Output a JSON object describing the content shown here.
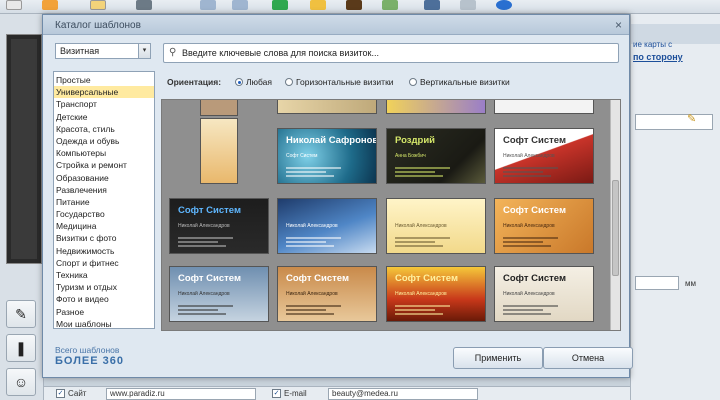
{
  "background": {
    "right_panel": {
      "link1": "ие карты с",
      "link2": "по сторону",
      "unit": "мм"
    },
    "bottom": {
      "site_label": "Сайт",
      "site_value": "www.paradiz.ru",
      "email_label": "E-mail",
      "email_value": "beauty@medea.ru"
    }
  },
  "dialog": {
    "title": "Каталог шаблонов",
    "category_select": "Визитная",
    "search_placeholder": "Введите ключевые слова для поиска визиток...",
    "categories": [
      "Простые",
      "Универсальные",
      "Транспорт",
      "Детские",
      "Красота, стиль",
      "Одежда и обувь",
      "Компьютеры",
      "Стройка и ремонт",
      "Образование",
      "Развлечения",
      "Питание",
      "Государство",
      "Медицина",
      "Визитки с фото",
      "Недвижимость",
      "Спорт и фитнес",
      "Техника",
      "Туризм и отдых",
      "Фото и видео",
      "Разное",
      "Мои шаблоны"
    ],
    "selected_category_index": 1,
    "orientation": {
      "label": "Ориентация:",
      "options": [
        "Любая",
        "Горизонтальные визитки",
        "Вертикальные визитки"
      ],
      "selected_index": 0
    },
    "templates": [
      {
        "title": "Николай Сафронов",
        "subtitle": "Софт Систем",
        "style": "blue-circles"
      },
      {
        "title": "Роздрий",
        "subtitle": "Анна Божбич",
        "style": "dark-flower"
      },
      {
        "title": "Софт Систем",
        "subtitle": "Николай Александров",
        "style": "red-swirl"
      },
      {
        "title": "Софт Систем",
        "subtitle": "Николай Александров",
        "style": "black"
      },
      {
        "title": "",
        "subtitle": "Николай Александров",
        "style": "blue-wave"
      },
      {
        "title": "",
        "subtitle": "Николай Александров",
        "style": "yellow"
      },
      {
        "title": "Софт Систем",
        "subtitle": "Николай Александров",
        "style": "orange-grunge"
      },
      {
        "title": "Софт Систем",
        "subtitle": "Николай Александров",
        "style": "blue-gray"
      },
      {
        "title": "Софт Систем",
        "subtitle": "Николай Александров",
        "style": "brown"
      },
      {
        "title": "Софт Систем",
        "subtitle": "Николай Александров",
        "style": "fire"
      },
      {
        "title": "Софт Систем",
        "subtitle": "Николай Александров",
        "style": "sketch"
      }
    ],
    "total_label": "Всего шаблонов",
    "total_value": "БОЛЕЕ 360",
    "apply_button": "Применить",
    "cancel_button": "Отмена"
  }
}
